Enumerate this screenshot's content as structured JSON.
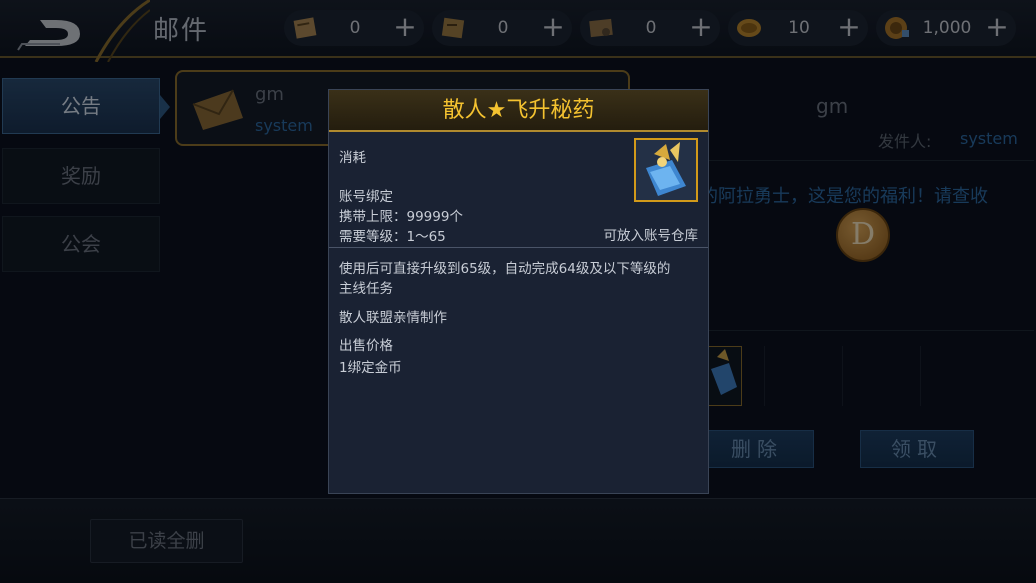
{
  "header": {
    "title": "邮件",
    "back_icon": "back-arrow-icon",
    "resources": [
      {
        "icon": "scroll-icon",
        "value": "0"
      },
      {
        "icon": "map-scroll-icon",
        "value": "0"
      },
      {
        "icon": "treasure-map-icon",
        "value": "0"
      },
      {
        "icon": "gold-coin-icon",
        "value": "10"
      },
      {
        "icon": "gem-coin-icon",
        "value": "1,000"
      }
    ],
    "plus_label": "+"
  },
  "tabs": [
    {
      "label": "公告",
      "active": true
    },
    {
      "label": "奖励",
      "active": false
    },
    {
      "label": "公会",
      "active": false
    }
  ],
  "mail_item": {
    "sender": "gm",
    "from": "system"
  },
  "detail": {
    "sender": "gm",
    "from_label": "发件人:",
    "from_value": "system",
    "body_visible": "的阿拉勇士，这是您的福利！请查收",
    "coin_letter": "D",
    "delete_label": "删除",
    "claim_label": "领取"
  },
  "footer": {
    "delete_read_label": "已读全删"
  },
  "tooltip": {
    "title": "散人★飞升秘药",
    "category": "消耗",
    "bind": "账号绑定",
    "stack_limit": "携带上限：99999个",
    "level_req": "需要等级：1～65",
    "storage_note": "可放入账号仓库",
    "desc_line1": "使用后可直接升级到65级，自动完成64级及以下等级的",
    "desc_line2": "主线任务",
    "maker": "散人联盟亲情制作",
    "price_label": "出售价格",
    "price_value": "1绑定金币",
    "item_icon": "potion-item-icon"
  },
  "colors": {
    "accent_gold": "#f4c230",
    "link_blue": "#2d6aa5",
    "active_tab": "#2a4a6e"
  }
}
